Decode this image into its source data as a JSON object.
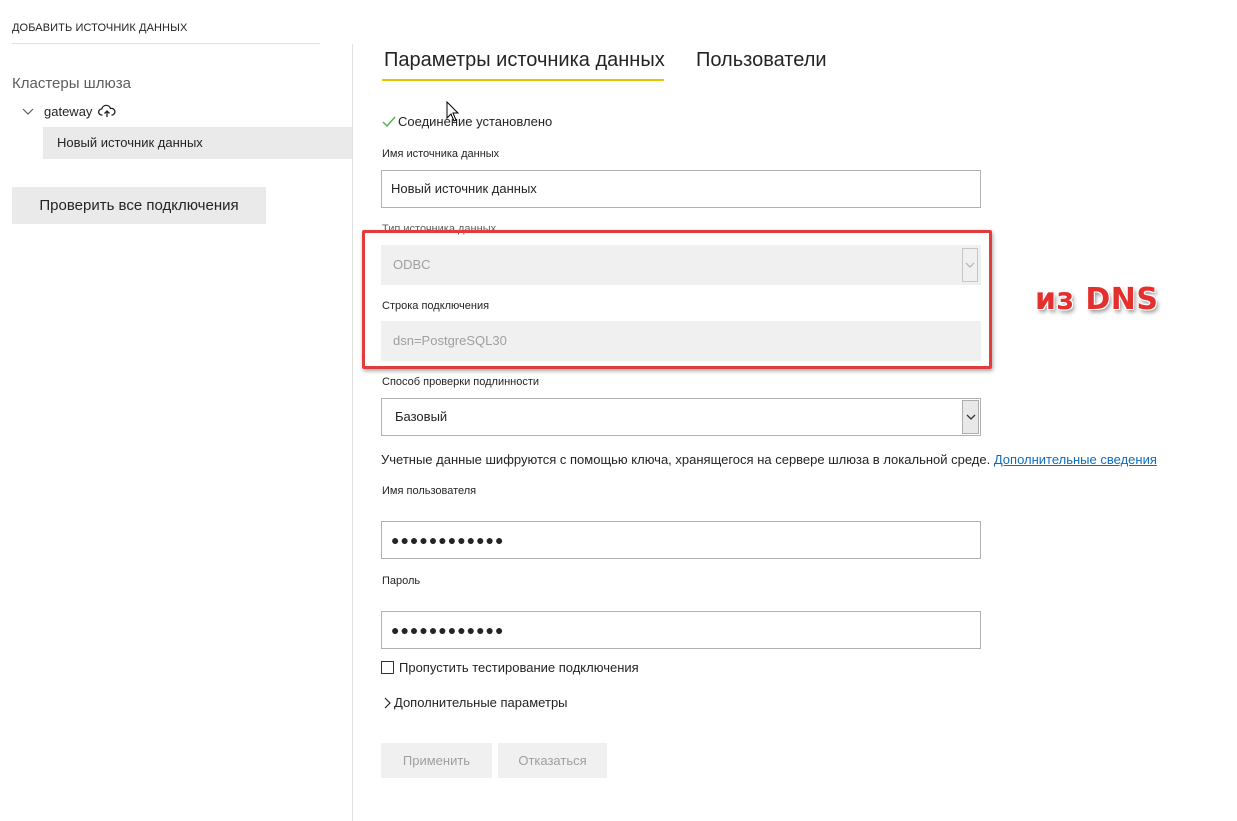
{
  "header": {
    "title": "ДОБАВИТЬ ИСТОЧНИК ДАННЫХ"
  },
  "sidebar": {
    "clusters_title": "Кластеры шлюза",
    "gateway_name": "gateway",
    "data_source_item": "Новый источник данных",
    "verify_all_button": "Проверить все подключения"
  },
  "tabs": [
    {
      "label": "Параметры источника данных",
      "active": true
    },
    {
      "label": "Пользователи",
      "active": false
    }
  ],
  "status": {
    "text": "Соединение установлено",
    "color": "#4caf50"
  },
  "form": {
    "ds_name_label": "Имя источника данных",
    "ds_name_value": "Новый источник данных",
    "ds_type_label": "Тип источника данных",
    "ds_type_value": "ODBC",
    "conn_string_label": "Строка подключения",
    "conn_string_value": "dsn=PostgreSQL30",
    "auth_label": "Способ проверки подлинности",
    "auth_value": "Базовый",
    "info_text": "Учетные данные шифруются с помощью ключа, хранящегося на сервере шлюза в локальной среде. ",
    "info_link": "Дополнительные сведения",
    "username_label": "Имя пользователя",
    "username_value": "●●●●●●●●●●●●",
    "password_label": "Пароль",
    "password_value": "●●●●●●●●●●●●",
    "skip_test_label": "Пропустить тестирование подключения",
    "advanced_label": "Дополнительные параметры",
    "apply_button": "Применить",
    "cancel_button": "Отказаться"
  },
  "annotation": {
    "text": "из DNS",
    "color": "#e42f2f"
  },
  "colors": {
    "accent_tab": "#e3c600",
    "link": "#0f6cbd",
    "annotation_border": "#e23b3b"
  }
}
